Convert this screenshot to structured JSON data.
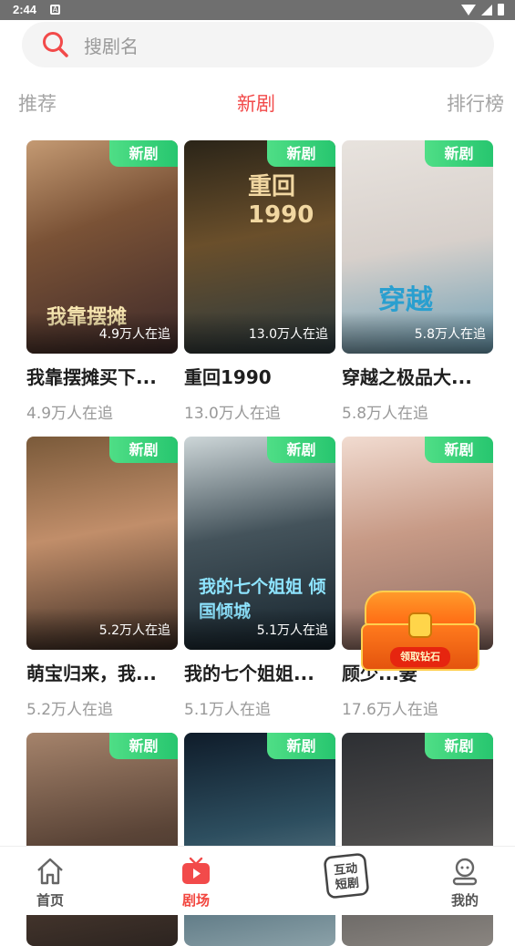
{
  "status": {
    "time": "2:44",
    "notification": "A"
  },
  "search": {
    "placeholder": "搜剧名"
  },
  "tabs": [
    {
      "label": "推荐",
      "active": false
    },
    {
      "label": "新剧",
      "active": true
    },
    {
      "label": "排行榜",
      "active": false
    }
  ],
  "badge_label": "新剧",
  "cards": [
    {
      "title": "我靠摆摊买下...",
      "overlay": "4.9万人在追",
      "follow": "4.9万人在追",
      "poster_text": "我靠摆摊"
    },
    {
      "title": "重回1990",
      "overlay": "13.0万人在追",
      "follow": "13.0万人在追",
      "poster_text": "重回1990"
    },
    {
      "title": "穿越之极品大...",
      "overlay": "5.8万人在追",
      "follow": "5.8万人在追",
      "poster_text": "穿越"
    },
    {
      "title": "萌宝归来，我...",
      "overlay": "5.2万人在追",
      "follow": "5.2万人在追",
      "poster_text": ""
    },
    {
      "title": "我的七个姐姐...",
      "overlay": "5.1万人在追",
      "follow": "5.1万人在追",
      "poster_text": "我的七个姐姐 倾国倾城"
    },
    {
      "title": "顾少...妻",
      "overlay": "",
      "follow": "17.6万人在追",
      "poster_text": ""
    },
    {
      "title": "",
      "overlay": "",
      "follow": "",
      "poster_text": ""
    },
    {
      "title": "",
      "overlay": "",
      "follow": "",
      "poster_text": ""
    },
    {
      "title": "",
      "overlay": "",
      "follow": "",
      "poster_text": ""
    }
  ],
  "chest": {
    "label": "领取钻石"
  },
  "nav": [
    {
      "label": "首页",
      "icon": "home-icon",
      "active": false
    },
    {
      "label": "剧场",
      "icon": "tv-icon",
      "active": true
    },
    {
      "label": "互动短剧",
      "icon": "interactive-drama-icon",
      "active": false
    },
    {
      "label": "我的",
      "icon": "profile-icon",
      "active": false
    }
  ],
  "colors": {
    "accent": "#f24a4a",
    "badge": "#2fd06f",
    "tab_inactive": "#a5a5a5"
  }
}
